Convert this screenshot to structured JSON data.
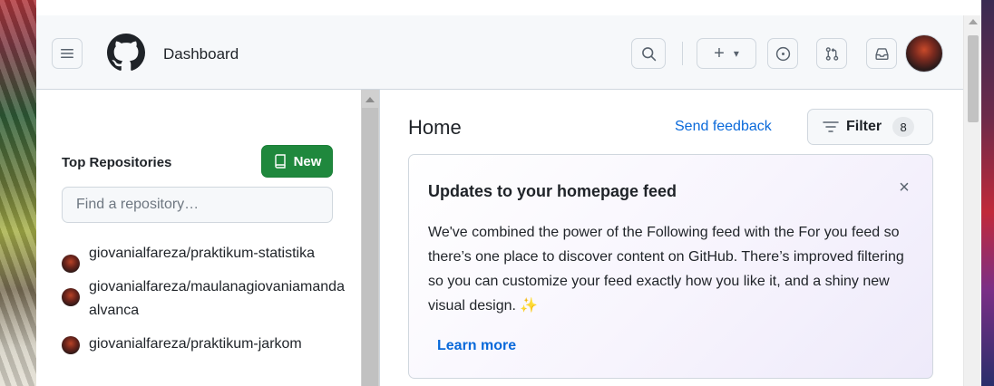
{
  "header": {
    "title": "Dashboard",
    "menu_icon": "hamburger-icon",
    "logo_icon": "github-octocat-icon",
    "search_icon": "search-icon",
    "create_plus": "+",
    "create_caret": "▾",
    "issues_icon": "issue-opened-icon",
    "pulls_icon": "git-pull-request-icon",
    "inbox_icon": "inbox-icon"
  },
  "sidebar": {
    "title": "Top Repositories",
    "new_button_label": "New",
    "find_placeholder": "Find a repository…",
    "repos": [
      {
        "name": "giovanialfareza/praktikum-statistika"
      },
      {
        "name": "giovanialfareza/maulanagiovaniamandaalvanca"
      },
      {
        "name": "giovanialfareza/praktikum-jarkom"
      }
    ]
  },
  "feed": {
    "home_title": "Home",
    "send_feedback": "Send feedback",
    "filter_label": "Filter",
    "filter_count": "8",
    "card": {
      "title": "Updates to your homepage feed",
      "close_glyph": "×",
      "body": "We've combined the power of the Following feed with the For you feed so there’s one place to discover content on GitHub. There’s improved filtering so you can customize your feed exactly how you like it, and a shiny new visual design.",
      "sparkle": "✨",
      "learn_more": "Learn more"
    }
  },
  "colors": {
    "accent_green": "#1f883d",
    "link_blue": "#0969da",
    "border": "#d0d7de",
    "header_bg": "#f6f8fa"
  }
}
